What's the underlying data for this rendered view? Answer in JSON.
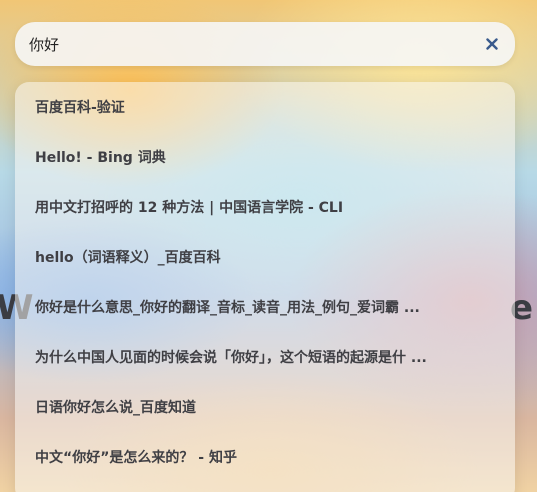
{
  "background": {
    "left_text": "W",
    "right_text": "e"
  },
  "search": {
    "value": "你好",
    "placeholder": "",
    "clear_icon": "close-icon"
  },
  "suggestions": [
    "百度百科-验证",
    "Hello! - Bing 词典",
    "用中文打招呼的 12 种方法 | 中国语言学院 - CLI",
    "hello（词语释义）_百度百科",
    "你好是什么意思_你好的翻译_音标_读音_用法_例句_爱词霸 ...",
    "为什么中国人见面的时候会说「你好」，这个短语的起源是什 ...",
    "日语你好怎么说_百度知道",
    "中文“你好”是怎么来的？ - 知乎"
  ],
  "colors": {
    "clear_icon": "#3a5a8c",
    "suggestion_text": "#3f3f44"
  }
}
